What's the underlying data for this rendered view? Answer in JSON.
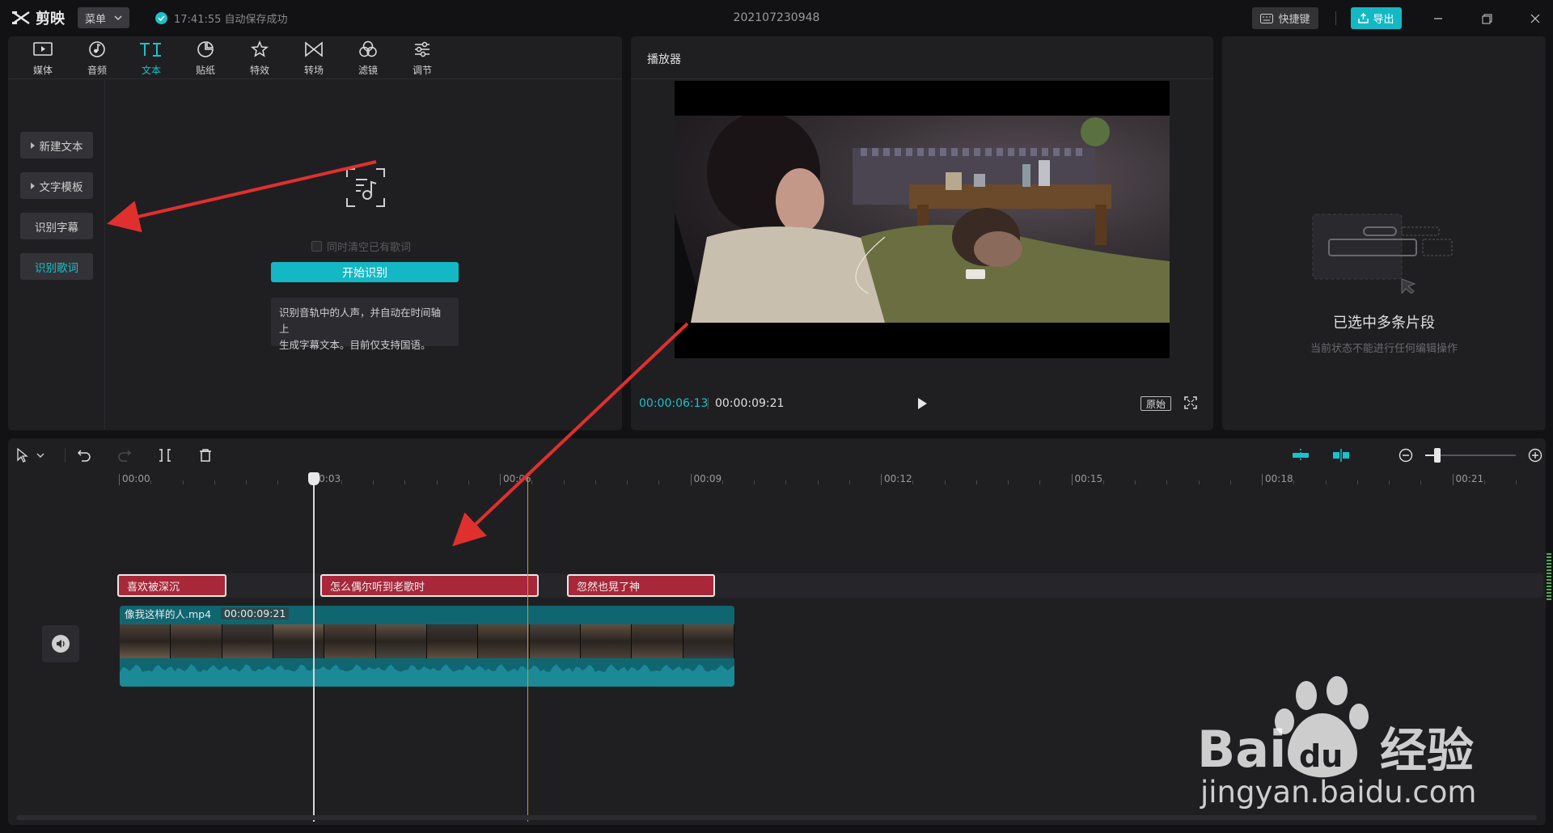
{
  "app": {
    "name": "剪映",
    "menu_label": "菜单",
    "autosave": "17:41:55 自动保存成功",
    "project_title": "202107230948",
    "shortcut_label": "快捷键",
    "export_label": "导出"
  },
  "toolbar": {
    "tools": [
      {
        "label": "媒体",
        "icon": "media-icon"
      },
      {
        "label": "音频",
        "icon": "audio-icon"
      },
      {
        "label": "文本",
        "icon": "text-icon",
        "active": true
      },
      {
        "label": "贴纸",
        "icon": "sticker-icon"
      },
      {
        "label": "特效",
        "icon": "effects-icon"
      },
      {
        "label": "转场",
        "icon": "transition-icon"
      },
      {
        "label": "滤镜",
        "icon": "filter-icon"
      },
      {
        "label": "调节",
        "icon": "adjust-icon"
      }
    ]
  },
  "subnav": {
    "items": [
      {
        "label": "新建文本"
      },
      {
        "label": "文字模板"
      },
      {
        "label": "识别字幕"
      },
      {
        "label": "识别歌词",
        "active": true
      }
    ]
  },
  "lyrics": {
    "clear_label": "同时清空已有歌词",
    "start_button": "开始识别",
    "info_line1": "识别音轨中的人声，并自动在时间轴上",
    "info_line2": "生成字幕文本。目前仅支持国语。"
  },
  "player": {
    "title": "播放器",
    "current_time": "00:00:06:13",
    "total_time": "00:00:09:21",
    "ratio_label": "原始"
  },
  "properties": {
    "empty_title": "已选中多条片段",
    "empty_subtitle": "当前状态不能进行任何编辑操作"
  },
  "timeline": {
    "ruler": [
      "00:00",
      "00:03",
      "00:06",
      "00:09",
      "00:12",
      "00:15",
      "00:18",
      "00:21"
    ],
    "text_clips": [
      {
        "text": "喜欢被深沉"
      },
      {
        "text": "怎么偶尔听到老歌时"
      },
      {
        "text": "忽然也晃了神"
      }
    ],
    "video_clip": {
      "name": "像我这样的人.mp4",
      "duration": "00:00:09:21"
    }
  },
  "watermark": {
    "brand": "Bai",
    "brand_du": "du",
    "brand_cn": "经验",
    "url": "jingyan.baidu.com"
  },
  "colors": {
    "accent": "#19c2cc",
    "text_clip": "#a82738",
    "video_clip": "#0f6670",
    "annotation_arrow": "#e0302e"
  }
}
